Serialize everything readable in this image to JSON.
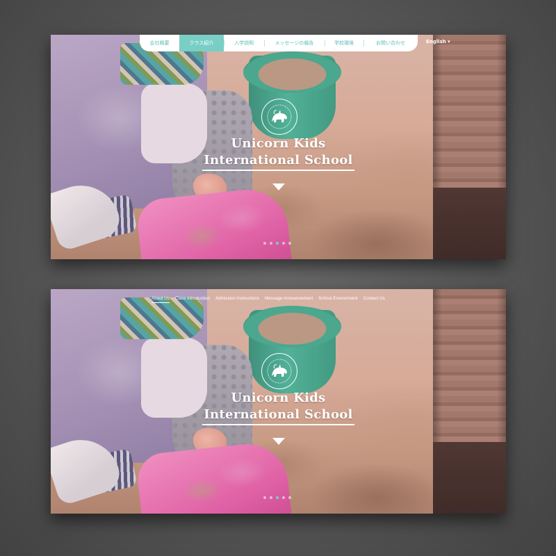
{
  "mockups": [
    {
      "nav_style": "japanese",
      "nav": [
        {
          "label": "会社概要",
          "active": false
        },
        {
          "label": "クラス紹介",
          "active": true
        },
        {
          "label": "入学説明",
          "active": false
        },
        {
          "label": "メッセージの報告",
          "active": false
        },
        {
          "label": "学校環境",
          "active": false
        },
        {
          "label": "お問い合わせ",
          "active": false
        }
      ],
      "language_label": "English ▾",
      "hero_title_line1": "Unicorn Kids",
      "hero_title_line2": "International School",
      "slide_count": 5,
      "active_slide": 2
    },
    {
      "nav_style": "english",
      "nav": [
        {
          "label": "About Us",
          "active": true
        },
        {
          "label": "Class introduction",
          "active": false
        },
        {
          "label": "Admission Instructions",
          "active": false
        },
        {
          "label": "Message Announcement",
          "active": false
        },
        {
          "label": "School Environment",
          "active": false
        },
        {
          "label": "Contact Us",
          "active": false
        }
      ],
      "hero_title_line1": "Unicorn Kids",
      "hero_title_line2": "International School",
      "slide_count": 5,
      "active_slide": 2
    }
  ],
  "colors": {
    "accent": "#79cfc5",
    "background": "#555555",
    "text_on_hero": "#ffffff"
  }
}
